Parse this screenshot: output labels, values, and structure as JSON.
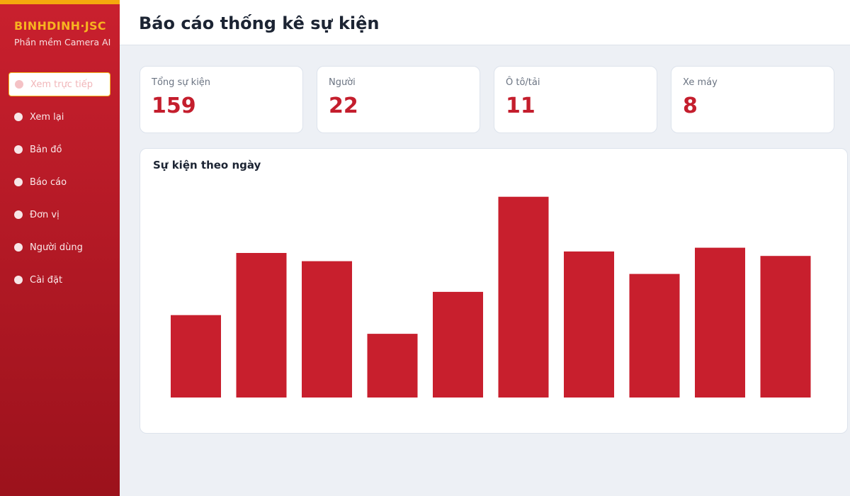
{
  "brand": {
    "name": "BINHDINH·JSC",
    "subtitle": "Phần mềm Camera AI"
  },
  "sidebar": {
    "items": [
      {
        "label": "Xem trực tiếp",
        "active": true
      },
      {
        "label": "Xem lại",
        "active": false
      },
      {
        "label": "Bản đồ",
        "active": false
      },
      {
        "label": "Báo cáo",
        "active": false
      },
      {
        "label": "Đơn vị",
        "active": false
      },
      {
        "label": "Người dùng",
        "active": false
      },
      {
        "label": "Cài đặt",
        "active": false
      }
    ]
  },
  "header": {
    "title": "Báo cáo thống kê sự kiện"
  },
  "stats": [
    {
      "label": "Tổng sự kiện",
      "value": "159"
    },
    {
      "label": "Người",
      "value": "22"
    },
    {
      "label": "Ô tô/tải",
      "value": "11"
    },
    {
      "label": "Xe máy",
      "value": "8"
    }
  ],
  "chart": {
    "title": "Sự kiện theo ngày"
  },
  "chart_data": {
    "type": "bar",
    "title": "Sự kiện theo ngày",
    "categories": [],
    "values": [
      11,
      19.3,
      18.2,
      8.5,
      14.1,
      26.8,
      19.5,
      16.5,
      20,
      18.9
    ],
    "ylim": [
      0,
      28
    ],
    "grid": false,
    "color": "#c81f2d"
  },
  "colors": {
    "accent": "#c81f2d",
    "brand_text": "#f7b320",
    "highlight_border": "#f5b51e"
  }
}
